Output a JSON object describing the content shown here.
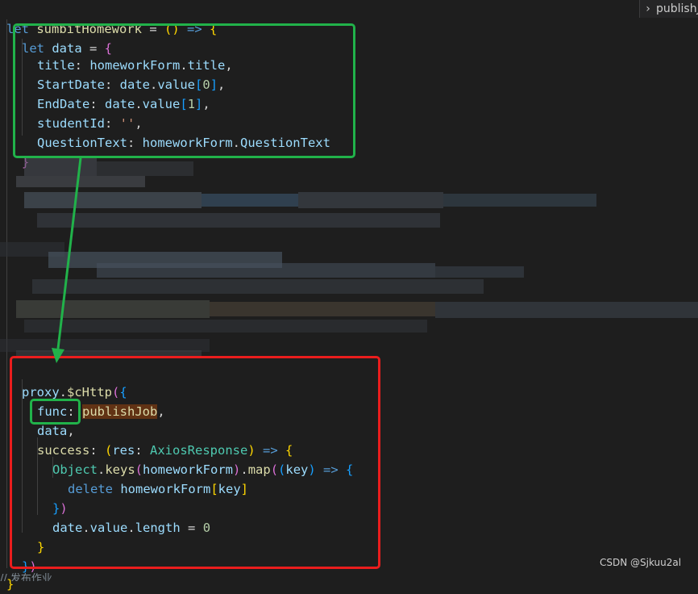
{
  "editor": {
    "breadcrumb": "publishJob",
    "watermark": "CSDN @Sjkuu2al",
    "bottom_comment": "// 发布作业"
  },
  "colors": {
    "background": "#1e1e1e",
    "green_box": "#21b24a",
    "red_box": "#ea1d1d",
    "arrow": "#21b24a"
  },
  "code": {
    "l1_let": "let",
    "l1_name": "sumbitHomework",
    "l1_eq": " = ",
    "l1_open": "()",
    "l1_arrow": " => ",
    "l1_brace": "{",
    "l2_let": "let",
    "l2_name": "data",
    "l2_eq": " = ",
    "l2_brace": "{",
    "l3_key": "title",
    "l3_val1": "homeworkForm",
    "l3_val2": "title",
    "l4_key": "StartDate",
    "l4_val1": "date",
    "l4_val2": "value",
    "l4_idx": "0",
    "l5_key": "EndDate",
    "l5_val1": "date",
    "l5_val2": "value",
    "l5_idx": "1",
    "l6_key": "studentId",
    "l6_val": "''",
    "l7_key": "QuestionText",
    "l7_val1": "homeworkForm",
    "l7_val2": "QuestionText",
    "l8_close": "}",
    "p1_obj": "proxy",
    "p1_fn": "$cHttp",
    "p2_key": "func",
    "p2_val": "publishJob",
    "p3_key": "data",
    "p4_key": "success",
    "p4_param": "res",
    "p4_type": "AxiosResponse",
    "p5_obj": "Object",
    "p5_fn": "keys",
    "p5_arg": "homeworkForm",
    "p5_map": "map",
    "p5_param": "key",
    "p6_kw": "delete",
    "p6_obj": "homeworkForm",
    "p6_key": "key",
    "p7_close": "})",
    "p8_1": "date",
    "p8_2": "value",
    "p8_3": "length",
    "p8_num": "0",
    "p9_close": "}",
    "p10_close": "})",
    "last_close": "}"
  }
}
